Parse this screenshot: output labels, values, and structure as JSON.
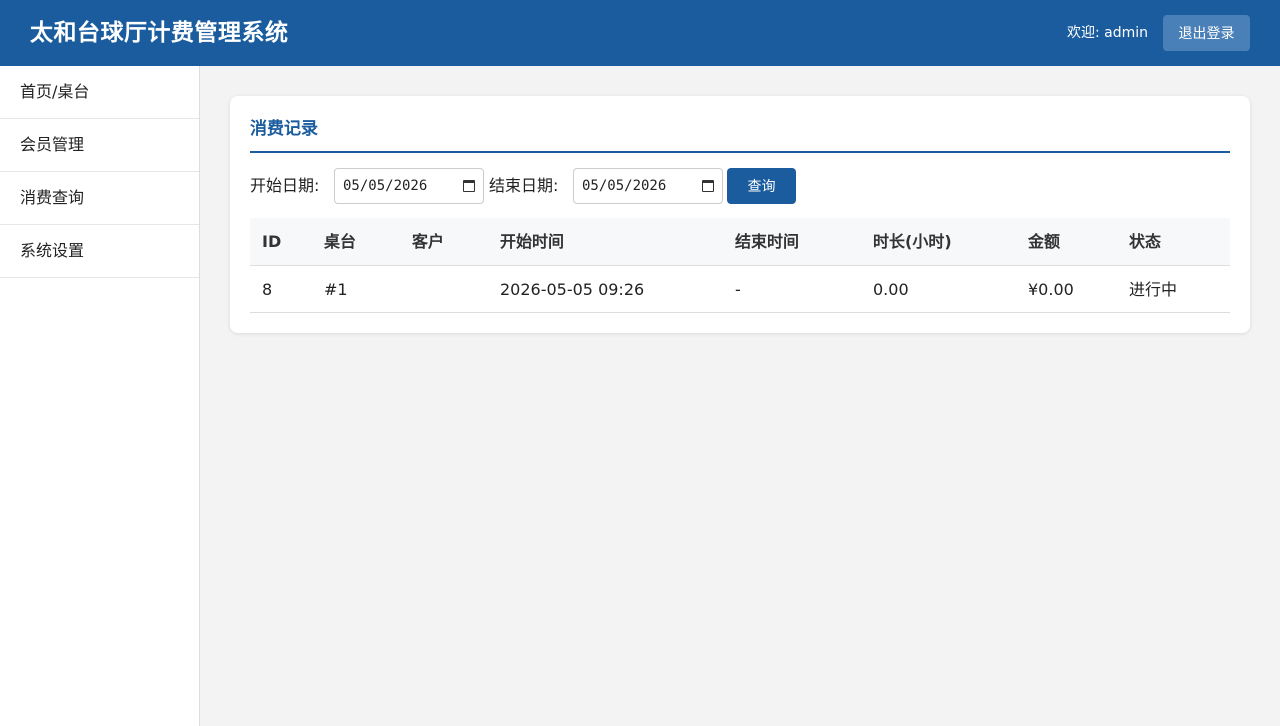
{
  "header": {
    "title": "太和台球厅计费管理系统",
    "welcome": "欢迎: admin",
    "logout_label": "退出登录"
  },
  "sidebar": {
    "items": [
      {
        "label": "首页/桌台"
      },
      {
        "label": "会员管理"
      },
      {
        "label": "消费查询"
      },
      {
        "label": "系统设置"
      }
    ]
  },
  "main": {
    "card_title": "消费记录",
    "filter": {
      "start_label": "开始日期:",
      "start_value": "05/05/2026",
      "end_label": "结束日期:",
      "end_value": "05/05/2026",
      "query_label": "查询"
    },
    "table": {
      "columns": [
        "ID",
        "桌台",
        "客户",
        "开始时间",
        "结束时间",
        "时长(小时)",
        "金额",
        "状态"
      ],
      "rows": [
        [
          "8",
          "#1",
          "",
          "2026-05-05 09:26",
          "-",
          "0.00",
          "¥0.00",
          "进行中"
        ]
      ]
    }
  },
  "colors": {
    "primary": "#1b5c9e",
    "logout_button": "#4a80b8",
    "background": "#f3f3f3"
  }
}
